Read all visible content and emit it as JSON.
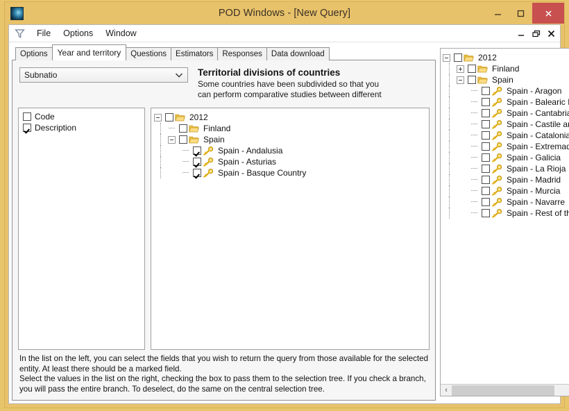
{
  "window": {
    "title": "POD Windows - [New Query]",
    "app_icon": "app-icon",
    "minimize": "–",
    "maximize": "□",
    "close": "✕"
  },
  "menubar": {
    "filter_icon": "funnel-icon",
    "items": [
      "File",
      "Options",
      "Window"
    ],
    "mdi_minimize": "–",
    "mdi_restore": "❐",
    "mdi_close": "✕"
  },
  "tabs": [
    {
      "label": "Options",
      "active": false
    },
    {
      "label": "Year and territory",
      "active": true
    },
    {
      "label": "Questions",
      "active": false
    },
    {
      "label": "Estimators",
      "active": false
    },
    {
      "label": "Responses",
      "active": false
    },
    {
      "label": "Data download",
      "active": false
    }
  ],
  "combo": {
    "value": "Subnatio",
    "chevron": "chevron-down-icon"
  },
  "description": {
    "heading": "Territorial divisions of countries",
    "line1": "Some countries have been subdivided so that you",
    "line2": "can perform comparative studies between different"
  },
  "fields": [
    {
      "label": "Code",
      "checked": false
    },
    {
      "label": "Description",
      "checked": true
    }
  ],
  "center_tree": [
    {
      "label": "2012",
      "level": 0,
      "icon": "folder-icon",
      "expander": "minus",
      "checked": false
    },
    {
      "label": "Finland",
      "level": 1,
      "icon": "folder-icon",
      "expander": "none",
      "checked": false
    },
    {
      "label": "Spain",
      "level": 1,
      "icon": "folder-icon",
      "expander": "minus",
      "checked": false
    },
    {
      "label": "Spain - Andalusia",
      "level": 2,
      "icon": "key-icon",
      "expander": "none",
      "checked": true
    },
    {
      "label": "Spain - Asturias",
      "level": 2,
      "icon": "key-icon",
      "expander": "none",
      "checked": true
    },
    {
      "label": "Spain - Basque Country",
      "level": 2,
      "icon": "key-icon",
      "expander": "none",
      "checked": true
    }
  ],
  "right_tree": [
    {
      "label": "2012",
      "level": 0,
      "icon": "folder-icon",
      "expander": "minus",
      "checked": false
    },
    {
      "label": "Finland",
      "level": 1,
      "icon": "folder-icon",
      "expander": "plus",
      "checked": false
    },
    {
      "label": "Spain",
      "level": 1,
      "icon": "folder-icon",
      "expander": "minus",
      "checked": false
    },
    {
      "label": "Spain - Aragon",
      "level": 2,
      "icon": "key-icon",
      "expander": "none",
      "checked": false
    },
    {
      "label": "Spain - Balearic Islands",
      "level": 2,
      "icon": "key-icon",
      "expander": "none",
      "checked": false
    },
    {
      "label": "Spain - Cantabria",
      "level": 2,
      "icon": "key-icon",
      "expander": "none",
      "checked": false
    },
    {
      "label": "Spain - Castile and Leon",
      "level": 2,
      "icon": "key-icon",
      "expander": "none",
      "checked": false
    },
    {
      "label": "Spain - Catalonia",
      "level": 2,
      "icon": "key-icon",
      "expander": "none",
      "checked": false
    },
    {
      "label": "Spain - Extremadura",
      "level": 2,
      "icon": "key-icon",
      "expander": "none",
      "checked": false
    },
    {
      "label": "Spain - Galicia",
      "level": 2,
      "icon": "key-icon",
      "expander": "none",
      "checked": false
    },
    {
      "label": "Spain - La Rioja",
      "level": 2,
      "icon": "key-icon",
      "expander": "none",
      "checked": false
    },
    {
      "label": "Spain - Madrid",
      "level": 2,
      "icon": "key-icon",
      "expander": "none",
      "checked": false
    },
    {
      "label": "Spain - Murcia",
      "level": 2,
      "icon": "key-icon",
      "expander": "none",
      "checked": false
    },
    {
      "label": "Spain - Navarre",
      "level": 2,
      "icon": "key-icon",
      "expander": "none",
      "checked": false
    },
    {
      "label": "Spain - Rest of the country",
      "level": 2,
      "icon": "key-icon",
      "expander": "none",
      "checked": false
    }
  ],
  "help": {
    "line1": "In the list on the left, you can select the fields that you wish to return the query from those available for the selected",
    "line2": "entity. At least there should be a marked field.",
    "line3": "Select the values in the list on the right, checking the box to pass them to the selection tree. If you check a branch,",
    "line4": "you will pass the entire branch. To deselect, do the same on the central selection tree."
  },
  "scrollbar": {
    "left_arrow": "‹",
    "right_arrow": "›",
    "thumb_percent": 71
  },
  "colors": {
    "frame": "#e8c26a",
    "close_button": "#c8504f",
    "folder": "#f5c342",
    "key": "#f0c020",
    "panel": "#f6f6f6"
  }
}
